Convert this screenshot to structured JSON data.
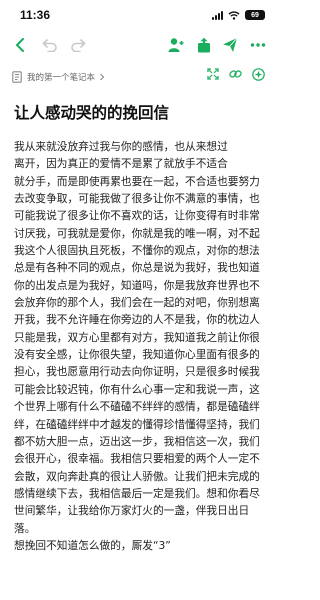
{
  "status_bar": {
    "time": "11:36",
    "battery": "69"
  },
  "toolbar": {
    "back_icon": "chevron-left-icon",
    "undo_icon": "undo-icon",
    "redo_icon": "redo-icon",
    "add_person_icon": "add-person-icon",
    "share_icon": "share-icon",
    "send_icon": "send-icon",
    "more_icon": "more-icon",
    "accent_color": "#1aad5d"
  },
  "notebook": {
    "name": "我的第一个笔记本"
  },
  "note": {
    "title": "让人感动哭的的挽回信",
    "lines": [
      "我从来就没放弃过我与你的感情，也从来想过",
      "离开，因为真正的爱情不是累了就放手不适合",
      "就分手，而是即使再累也要在一起，不合适也要努力",
      "去改变争取，可能我做了很多让你不满意的事情，也",
      "可能我说了很多让你不喜欢的话，让你变得有时非常",
      "讨厌我，可我就是爱你，你就是我的唯一啊，对不起",
      "我这个人很固执且死板，不懂你的观点，对你的想法",
      "总是有各种不同的观点，你总是说为我好，我也知道",
      "你的出发点是为我好，知道吗，你是我放弃世界也不",
      "会放弃你的那个人，我们会在一起的对吧，你别想离",
      "开我，我不允许睡在你旁边的人不是我，你的枕边人",
      "只能是我，双方心里都有对方，我知道我之前让你很",
      "没有安全感，让你很失望，我知道你心里面有很多的",
      "担心，我也愿意用行动去向你证明，只是很多时候我",
      "可能会比较迟钝，你有什么心事一定和我说一声，这",
      "个世界上哪有什么不磕磕不绊绊的感情，都是磕磕绊",
      "绊，在磕磕绊绊中才越发的懂得珍惜懂得坚持，我们",
      "都不妨大胆一点，迈出这一步，我相信这一次，我们",
      "会很开心，很幸福。我相信只要相爱的两个人一定不",
      "会散，双向奔赴真的很让人骄傲。让我们把未完成的",
      "感情继续下去，我相信最后一定是我们。想和你看尽",
      "世间繁华，让我给你万家灯火的一盏，伴我日出日",
      "落。",
      "想挽回不知道怎么做的，厮发“3”"
    ]
  }
}
